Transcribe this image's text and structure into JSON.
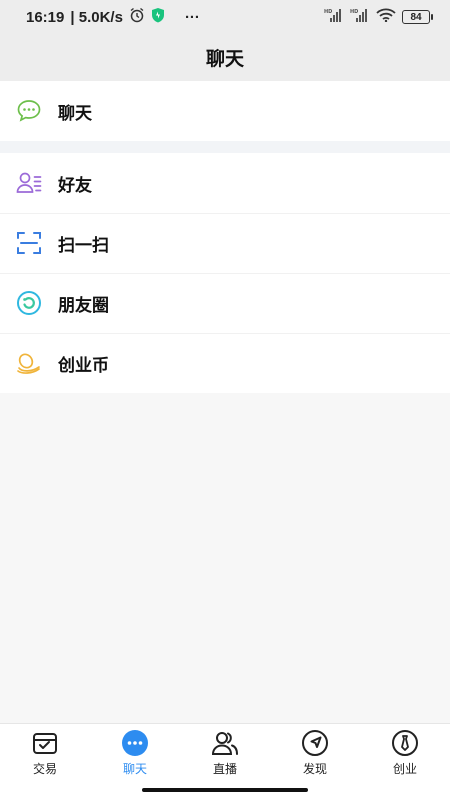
{
  "status_bar": {
    "time": "16:19",
    "speed": "| 5.0K/s",
    "more": "···",
    "battery": "84"
  },
  "header": {
    "title": "聊天"
  },
  "list": {
    "group1": [
      {
        "label": "聊天",
        "icon": "chat-bubbles-icon"
      }
    ],
    "group2": [
      {
        "label": "好友",
        "icon": "contacts-icon"
      },
      {
        "label": "扫一扫",
        "icon": "scan-icon"
      },
      {
        "label": "朋友圈",
        "icon": "moments-icon"
      },
      {
        "label": "创业币",
        "icon": "coins-icon"
      }
    ]
  },
  "tabs": [
    {
      "label": "交易",
      "icon": "trade-box-icon",
      "active": false
    },
    {
      "label": "聊天",
      "icon": "chat-dots-icon",
      "active": true
    },
    {
      "label": "直播",
      "icon": "live-users-icon",
      "active": false
    },
    {
      "label": "发现",
      "icon": "compass-icon",
      "active": false
    },
    {
      "label": "创业",
      "icon": "startup-icon",
      "active": false
    }
  ],
  "colors": {
    "accent": "#2d8cf0",
    "chat_icon": "#6dbf4b",
    "contacts_icon": "#9b6ad8",
    "scan_icon": "#3a7de0",
    "moments_icon": "#2fb8e0",
    "coins_icon": "#f0b43a"
  }
}
